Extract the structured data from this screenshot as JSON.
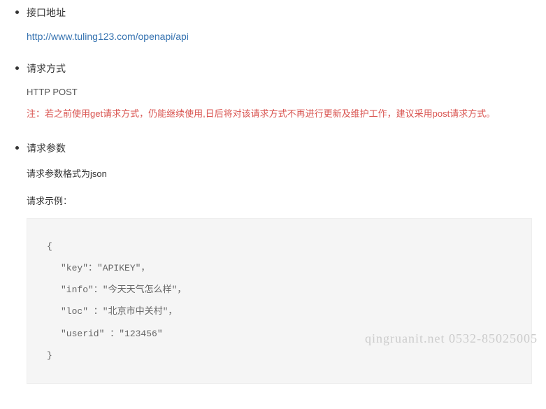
{
  "sections": {
    "endpoint": {
      "title": "接口地址",
      "url": "http://www.tuling123.com/openapi/api"
    },
    "method": {
      "title": "请求方式",
      "value": "HTTP POST",
      "note": "注：若之前使用get请求方式，仍能继续使用,日后将对该请求方式不再进行更新及维护工作，建议采用post请求方式。"
    },
    "params": {
      "title": "请求参数",
      "desc": "请求参数格式为json",
      "example_label": "请求示例：",
      "code": {
        "open": "{",
        "l1": "\"key\"：\"APIKEY\"，",
        "l2": "\"info\"：\"今天天气怎么样\"，",
        "l3": "\"loc\" ：\"北京市中关村\"，",
        "l4": "\"userid\" ：\"123456\"",
        "close": "}"
      }
    }
  },
  "watermark": "qingruanit.net 0532-85025005"
}
